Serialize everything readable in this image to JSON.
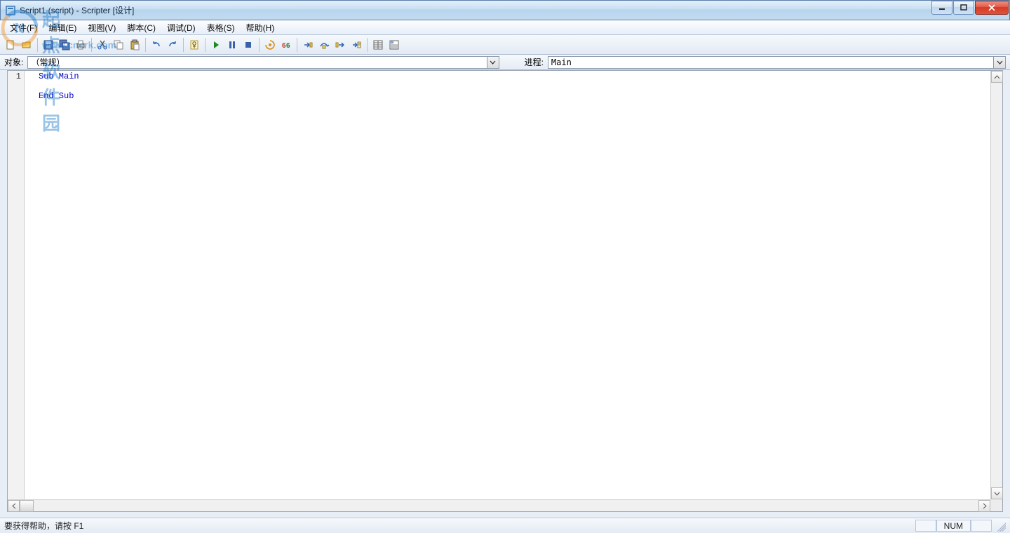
{
  "title": "Script1 (script) - Scripter [设计]",
  "menu": {
    "file": "文件(F)",
    "edit": "编辑(E)",
    "view": "视图(V)",
    "script": "脚本(C)",
    "debug": "调试(D)",
    "table": "表格(S)",
    "help": "帮助(H)"
  },
  "toolbar_icons": {
    "new": "new-file-icon",
    "open": "open-file-icon",
    "save": "save-icon",
    "saveall": "save-all-icon",
    "print": "print-icon",
    "cut": "cut-icon",
    "copy": "copy-icon",
    "paste": "paste-icon",
    "undo": "undo-icon",
    "redo": "redo-icon",
    "references": "references-icon",
    "run": "run-icon",
    "pause": "pause-icon",
    "stop": "stop-icon",
    "breakpoint": "breakpoint-icon",
    "watch": "watch-icon",
    "stepinto": "step-into-icon",
    "stepover": "step-over-icon",
    "stepout": "step-out-icon",
    "stepcursor": "step-to-cursor-icon",
    "properties": "properties-icon",
    "objectbrowser": "object-browser-icon"
  },
  "selectors": {
    "object_label": "对象:",
    "object_value": "（常规）",
    "process_label": "进程:",
    "process_value": "Main"
  },
  "code": {
    "line_number": "1",
    "line1": "Sub Main",
    "line3": "End Sub"
  },
  "status": {
    "help": "要获得帮助，请按 F1",
    "num": "NUM"
  },
  "watermark": {
    "text": "起点软件园",
    "url": "www.cncrk.com"
  }
}
